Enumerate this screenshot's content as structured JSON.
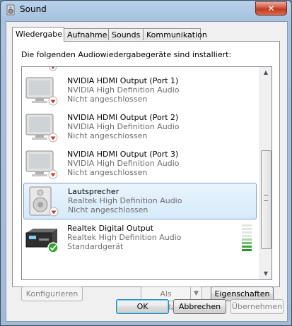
{
  "window": {
    "title": "Sound",
    "close_label": "✕"
  },
  "tabs": [
    {
      "label": "Wiedergabe",
      "active": true
    },
    {
      "label": "Aufnahme",
      "active": false
    },
    {
      "label": "Sounds",
      "active": false
    },
    {
      "label": "Kommunikation",
      "active": false
    }
  ],
  "instruction": "Die folgenden Audiowiedergabegeräte sind installiert:",
  "devices": [
    {
      "name": "NVIDIA HDMI Output (Port 1)",
      "driver": "NVIDIA High Definition Audio",
      "status": "Nicht angeschlossen",
      "icon": "monitor-icon"
    },
    {
      "name": "NVIDIA HDMI Output (Port 2)",
      "driver": "NVIDIA High Definition Audio",
      "status": "Nicht angeschlossen",
      "icon": "monitor-icon"
    },
    {
      "name": "NVIDIA HDMI Output (Port 3)",
      "driver": "NVIDIA High Definition Audio",
      "status": "Nicht angeschlossen",
      "icon": "monitor-icon"
    },
    {
      "name": "Lautsprecher",
      "driver": "Realtek High Definition Audio",
      "status": "Nicht angeschlossen",
      "icon": "speaker-icon",
      "selected": true
    },
    {
      "name": "Realtek Digital Output",
      "driver": "Realtek High Definition Audio",
      "status": "Standardgerät",
      "icon": "digital-output-icon",
      "default": true
    }
  ],
  "buttons": {
    "configure": "Konfigurieren",
    "set_default": "Als Standard",
    "properties": "Eigenschaften",
    "ok": "OK",
    "cancel": "Abbrechen",
    "apply": "Übernehmen"
  },
  "colors": {
    "selection": "#d6eafb",
    "meter_green": "#3aa33a",
    "status_red": "#c8342a",
    "status_green": "#2fa52f"
  }
}
